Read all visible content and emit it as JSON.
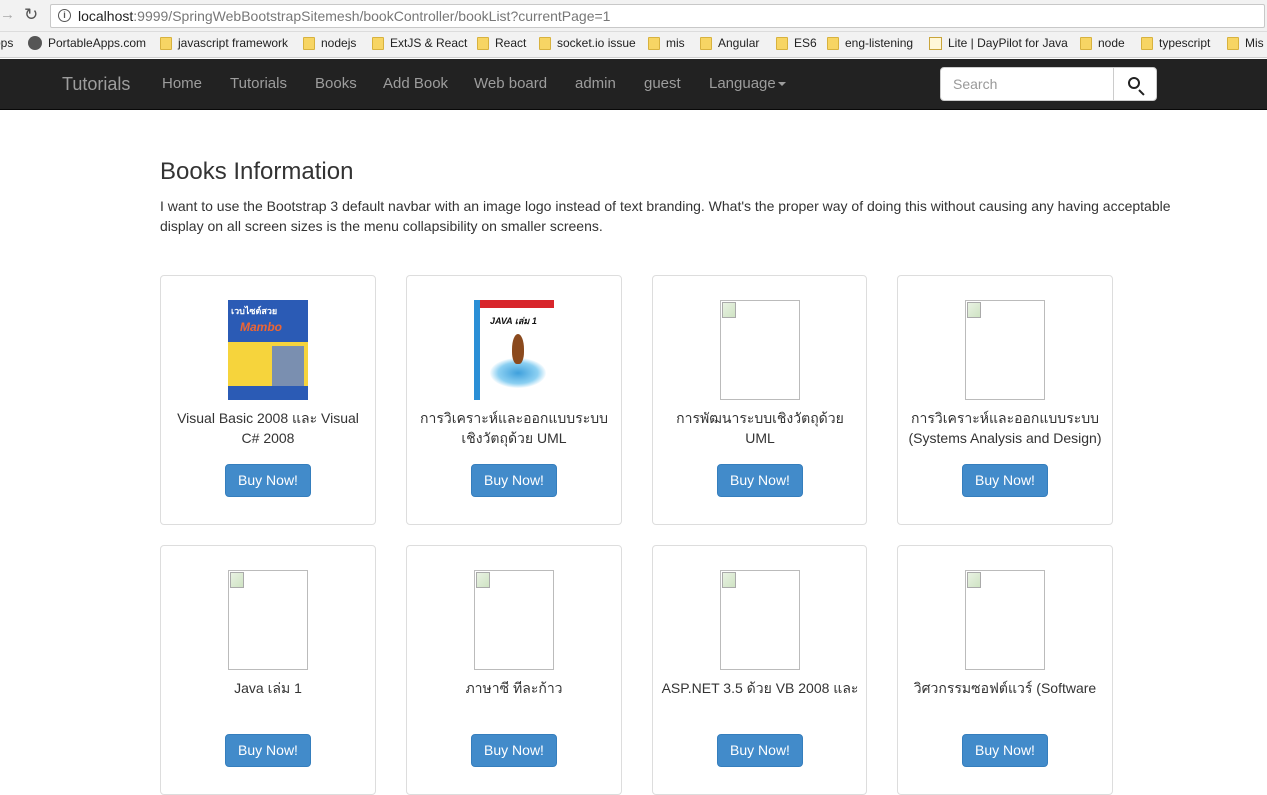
{
  "browser": {
    "url_host": "localhost",
    "url_rest": ":9999/SpringWebBootstrapSitemesh/bookController/bookList?currentPage=1",
    "bookmarks": [
      {
        "label": "ops",
        "icon": "folder-icon"
      },
      {
        "label": "PortableApps.com",
        "icon": "portableapps-icon"
      },
      {
        "label": "javascript framework",
        "icon": "folder-icon"
      },
      {
        "label": "nodejs",
        "icon": "folder-icon"
      },
      {
        "label": "ExtJS & React",
        "icon": "folder-icon"
      },
      {
        "label": "React",
        "icon": "folder-icon"
      },
      {
        "label": "socket.io issue",
        "icon": "folder-icon"
      },
      {
        "label": "mis",
        "icon": "folder-icon"
      },
      {
        "label": "Angular",
        "icon": "folder-icon"
      },
      {
        "label": "ES6",
        "icon": "folder-icon"
      },
      {
        "label": "eng-listening",
        "icon": "folder-icon"
      },
      {
        "label": "Lite | DayPilot for Java",
        "icon": "page-icon"
      },
      {
        "label": "node",
        "icon": "folder-icon"
      },
      {
        "label": "typescript",
        "icon": "folder-icon"
      },
      {
        "label": "Mis",
        "icon": "folder-icon"
      }
    ]
  },
  "navbar": {
    "brand": "Tutorials",
    "links": [
      "Home",
      "Tutorials",
      "Books",
      "Add Book",
      "Web board",
      "admin",
      "guest"
    ],
    "language": "Language",
    "search_placeholder": "Search"
  },
  "main": {
    "title": "Books Information",
    "intro": "I want to use the Bootstrap 3 default navbar with an image logo instead of text branding. What's the proper way of doing this without causing any having acceptable display on all screen sizes is the menu collapsibility on smaller screens.",
    "buy_label": "Buy Now!",
    "books": [
      {
        "title": "Visual Basic 2008 และ Visual C# 2008",
        "cover": "mambo"
      },
      {
        "title": "การวิเคราะห์และออกแบบระบบเชิงวัตถุด้วย UML",
        "cover": "java"
      },
      {
        "title": "การพัฒนาระบบเชิงวัตถุด้วย UML",
        "cover": "broken"
      },
      {
        "title": "การวิเคราะห์และออกแบบระบบ (Systems Analysis and Design)",
        "cover": "broken"
      },
      {
        "title": "Java เล่ม 1",
        "cover": "broken"
      },
      {
        "title": "ภาษาซี ทีละก้าว",
        "cover": "broken"
      },
      {
        "title": "ASP.NET 3.5 ด้วย VB 2008 และ",
        "cover": "broken"
      },
      {
        "title": "วิศวกรรมซอฟต์แวร์ (Software",
        "cover": "broken"
      }
    ],
    "cover1_text": {
      "line1": "เวบไซต์สวย",
      "line2": "Mambo"
    },
    "cover2_text": "JAVA เล่ม 1"
  }
}
